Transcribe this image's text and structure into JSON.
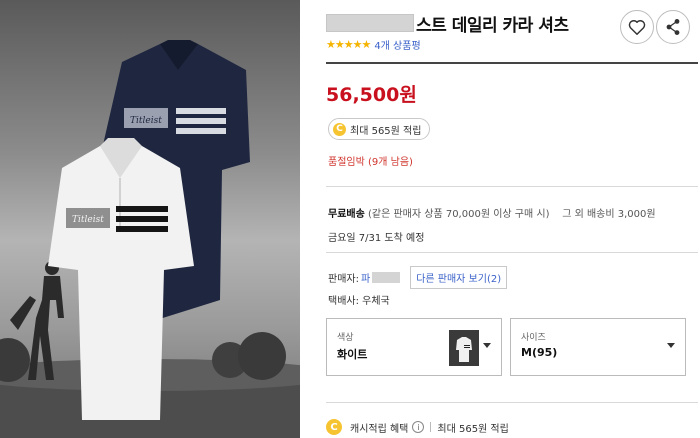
{
  "product": {
    "title_suffix": "스트 데일리 카라 셔츠",
    "stars": "★★★★★",
    "review_link": "4개 상품평",
    "price": "56,500원",
    "point_badge_coin": "C",
    "point_badge_text": "최대 565원 적립",
    "stock_status": "품절임박 (9개 남음)"
  },
  "shipping": {
    "free_label": "무료배송",
    "free_condition": "(같은 판매자 상품 70,000원 이상 구매 시)",
    "other_fee": "그 외 배송비 3,000원",
    "arrival": "금요일 7/31 도착 예정"
  },
  "seller": {
    "label": "판매자:",
    "name_prefix": "파",
    "other_seller_button": "다른 판매자 보기(2)",
    "courier": "택배사: 우체국"
  },
  "options": {
    "color_label": "색상",
    "color_value": "화이트",
    "size_label": "사이즈",
    "size_value": "M(95)"
  },
  "cashback": {
    "coin": "C",
    "label": "캐시적립 혜택",
    "info": "i",
    "amount": "최대 565원 적립"
  },
  "image": {
    "logo_text": "Titleist"
  },
  "colors": {
    "price_red": "#c8101e",
    "link_blue": "#3b62c9",
    "star_gold": "#f5b400",
    "stock_red": "#d0342c"
  },
  "icons": {
    "wishlist": "heart-icon",
    "share": "share-icon",
    "dropdown": "chevron-down-icon",
    "info": "info-icon"
  }
}
